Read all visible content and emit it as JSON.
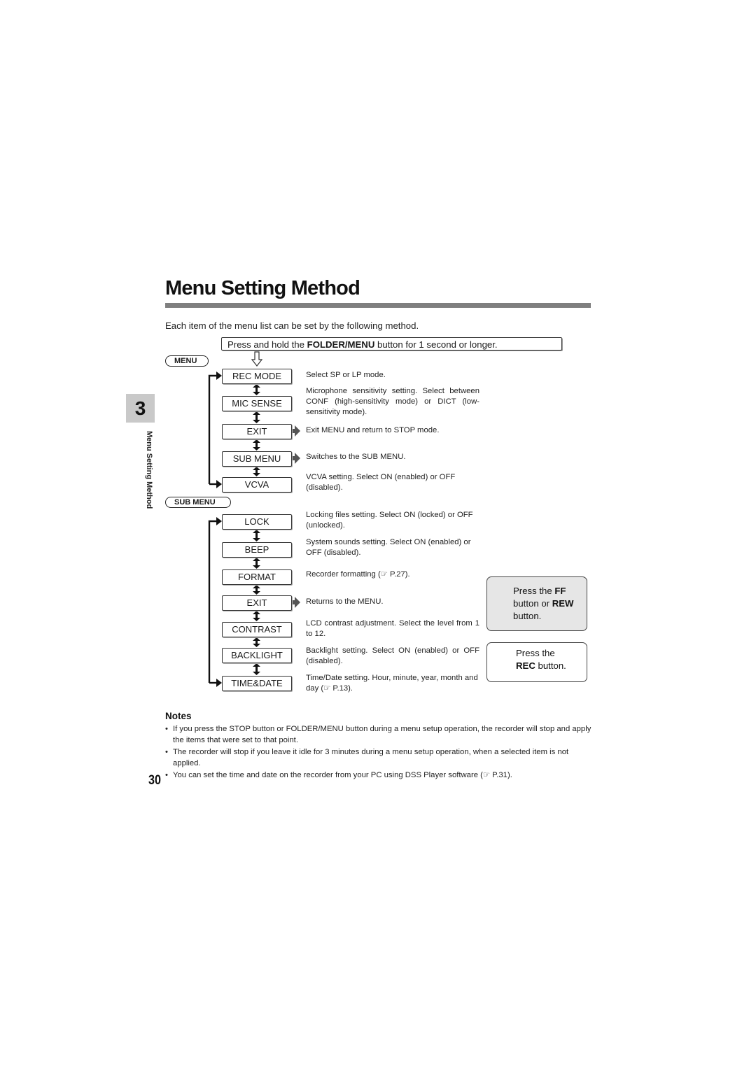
{
  "page": {
    "title": "Menu Setting Method",
    "intro": "Each item of the menu list can be set by the following method.",
    "hold_instruction": {
      "prefix": "Press and hold the ",
      "bold": "FOLDER/MENU",
      "suffix": " button for 1 second or longer."
    },
    "chapter_tab": "3",
    "side_label": "Menu Setting Method",
    "page_number": "30"
  },
  "menu": {
    "label": "MENU",
    "items": [
      {
        "label": "REC MODE",
        "desc": "Select SP or LP mode.",
        "connector": "none"
      },
      {
        "label": "MIC SENSE",
        "desc": "Microphone sensitivity setting. Select between CONF (high-sensitivity mode) or DICT (low-sensitivity mode).",
        "connector": "none"
      },
      {
        "label": "EXIT",
        "desc": "Exit MENU and return to STOP mode.",
        "connector": "arrow"
      },
      {
        "label": "SUB MENU",
        "desc": "Switches to the SUB MENU.",
        "connector": "arrow"
      },
      {
        "label": "VCVA",
        "desc": "VCVA setting. Select ON (enabled) or OFF (disabled).",
        "connector": "none"
      }
    ]
  },
  "sub_menu": {
    "label": "SUB MENU",
    "items": [
      {
        "label": "LOCK",
        "desc": "Locking files setting. Select ON (locked) or OFF (unlocked).",
        "connector": "none"
      },
      {
        "label": "BEEP",
        "desc": "System sounds setting. Select ON (enabled) or OFF (disabled).",
        "connector": "none"
      },
      {
        "label": "FORMAT",
        "desc": "Recorder formatting (☞ P.27).",
        "connector": "none"
      },
      {
        "label": "EXIT",
        "desc": "Returns to the MENU.",
        "connector": "arrow"
      },
      {
        "label": "CONTRAST",
        "desc": "LCD contrast adjustment. Select the level from 1 to 12.",
        "connector": "none"
      },
      {
        "label": "BACKLIGHT",
        "desc": "Backlight setting. Select ON (enabled) or OFF (disabled).",
        "connector": "none"
      },
      {
        "label": "TIME&DATE",
        "desc": "Time/Date setting. Hour, minute, year, month and day (☞ P.13).",
        "connector": "none"
      }
    ]
  },
  "legend": {
    "ff_rew": {
      "l1_a": "Press the ",
      "l1_b": "FF",
      "l2_a": "button or ",
      "l2_b": "REW",
      "l3": "button."
    },
    "rec": {
      "l1": "Press the",
      "l2_b": "REC",
      "l2_a": " button."
    }
  },
  "notes": {
    "title": "Notes",
    "bullet": "•",
    "items": [
      "If you press the STOP button or FOLDER/MENU button during a menu setup operation, the recorder will stop and apply the items that were set to that point.",
      "The recorder will stop if you leave it idle for 3 minutes during a menu setup operation, when a selected item is not applied.",
      "You can set the time and date on the recorder from your PC using DSS Player software (☞ P.31)."
    ]
  },
  "colors": {
    "rule": "#7f7f7f",
    "tab": "#c9c9c9",
    "legend_fill": "#e6e6e6",
    "arrow_gray": "#555555"
  }
}
